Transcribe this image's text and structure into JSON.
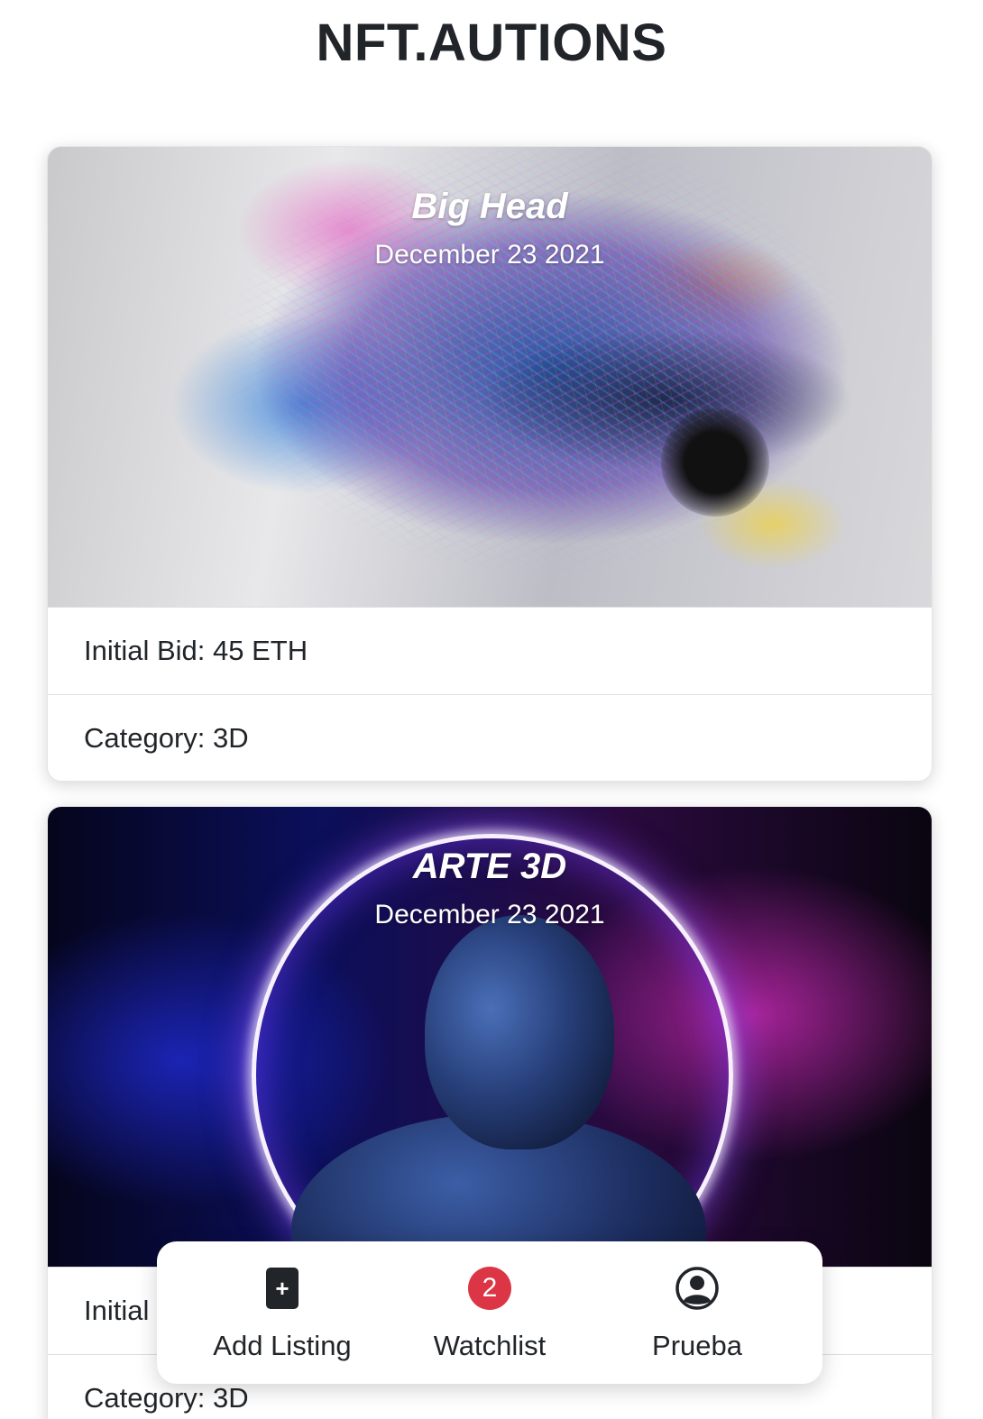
{
  "header": {
    "title": "NFT.AUTIONS"
  },
  "listings": [
    {
      "title": "Big Head",
      "date": "December 23 2021",
      "initial_bid": "Initial Bid: 45 ETH",
      "category": "Category: 3D",
      "image_icon": "abstract-face-artwork"
    },
    {
      "title": "ARTE 3D",
      "date": "December 23 2021",
      "initial_bid_visible": "Initial",
      "category": "Category: 3D",
      "image_icon": "neon-ring-figure-artwork"
    }
  ],
  "bottom_nav": {
    "add_listing": {
      "label": "Add Listing",
      "icon": "plus-square-icon",
      "icon_text": "+"
    },
    "watchlist": {
      "label": "Watchlist",
      "icon": "badge-count-icon",
      "count": "2"
    },
    "profile": {
      "label": "Prueba",
      "icon": "person-circle-icon"
    }
  },
  "colors": {
    "text": "#212529",
    "badge": "#dc3545",
    "card_border": "rgba(0,0,0,0.1)",
    "background": "#ffffff"
  }
}
